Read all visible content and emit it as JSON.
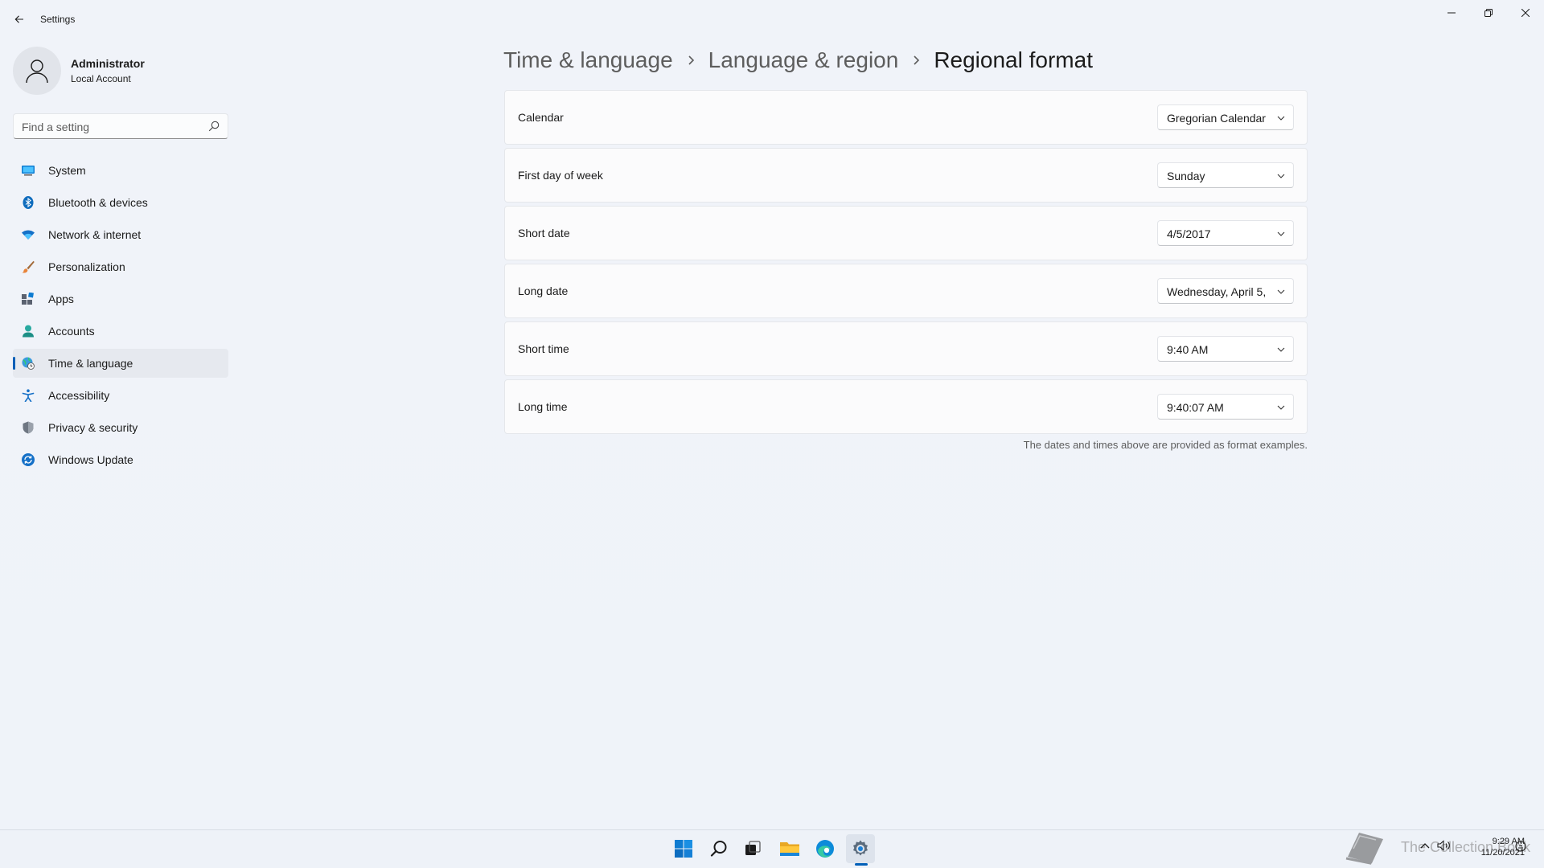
{
  "window": {
    "title": "Settings",
    "controls": {
      "minimize": "minimize-icon",
      "restore": "restore-icon",
      "close": "close-icon"
    }
  },
  "profile": {
    "name": "Administrator",
    "account_type": "Local Account"
  },
  "search": {
    "placeholder": "Find a setting",
    "value": ""
  },
  "sidebar": {
    "active": "Time & language",
    "items": [
      {
        "label": "System",
        "icon": "system-icon"
      },
      {
        "label": "Bluetooth & devices",
        "icon": "bluetooth-icon"
      },
      {
        "label": "Network & internet",
        "icon": "wifi-icon"
      },
      {
        "label": "Personalization",
        "icon": "brush-icon"
      },
      {
        "label": "Apps",
        "icon": "apps-icon"
      },
      {
        "label": "Accounts",
        "icon": "account-icon"
      },
      {
        "label": "Time & language",
        "icon": "globe-clock-icon"
      },
      {
        "label": "Accessibility",
        "icon": "accessibility-icon"
      },
      {
        "label": "Privacy & security",
        "icon": "shield-icon"
      },
      {
        "label": "Windows Update",
        "icon": "update-icon"
      }
    ]
  },
  "breadcrumb": [
    "Time & language",
    "Language & region",
    "Regional format"
  ],
  "settings": [
    {
      "label": "Calendar",
      "value": "Gregorian Calendar"
    },
    {
      "label": "First day of week",
      "value": "Sunday"
    },
    {
      "label": "Short date",
      "value": "4/5/2017"
    },
    {
      "label": "Long date",
      "value": "Wednesday, April 5,"
    },
    {
      "label": "Short time",
      "value": "9:40 AM"
    },
    {
      "label": "Long time",
      "value": "9:40:07 AM"
    }
  ],
  "footnote": "The dates and times above are provided as format examples.",
  "taskbar": {
    "apps": [
      "start-icon",
      "search-icon",
      "task-view-icon",
      "file-explorer-icon",
      "edge-icon",
      "settings-icon"
    ],
    "active_app": "settings-icon",
    "clock": {
      "time": "9:29 AM",
      "date": "11/20/2021"
    },
    "watermark": "The Collection Book"
  },
  "colors": {
    "accent": "#005fb8",
    "background": "#eff3f9",
    "card": "#fbfbfc"
  }
}
